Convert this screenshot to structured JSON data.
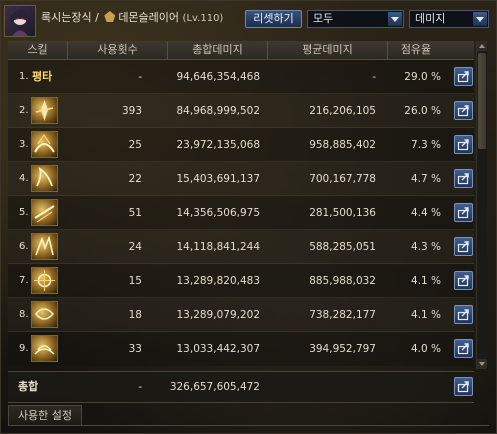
{
  "header": {
    "character_name": "록시는장식 / ",
    "class_name": "데몬슬레이어",
    "level": "(Lv.110)",
    "reset_button": "리셋하기",
    "filter_dropdown": "모두",
    "metric_dropdown": "데미지"
  },
  "table": {
    "columns": [
      "스킬",
      "사용횟수",
      "총합데미지",
      "평균데미지",
      "점유율"
    ],
    "rows": [
      {
        "rank": "1.",
        "skill_text": "평타",
        "uses": "-",
        "total": "94,646,354,468",
        "avg": "-",
        "share": "29.0 %"
      },
      {
        "rank": "2.",
        "skill_icon": "demon-skill-icon-1",
        "uses": "393",
        "total": "84,968,999,502",
        "avg": "216,206,105",
        "share": "26.0 %"
      },
      {
        "rank": "3.",
        "skill_icon": "demon-skill-icon-2",
        "uses": "25",
        "total": "23,972,135,068",
        "avg": "958,885,402",
        "share": "7.3 %"
      },
      {
        "rank": "4.",
        "skill_icon": "demon-skill-icon-3",
        "uses": "22",
        "total": "15,403,691,137",
        "avg": "700,167,778",
        "share": "4.7 %"
      },
      {
        "rank": "5.",
        "skill_icon": "demon-skill-icon-4",
        "uses": "51",
        "total": "14,356,506,975",
        "avg": "281,500,136",
        "share": "4.4 %"
      },
      {
        "rank": "6.",
        "skill_icon": "demon-skill-icon-5",
        "uses": "24",
        "total": "14,118,841,244",
        "avg": "588,285,051",
        "share": "4.3 %"
      },
      {
        "rank": "7.",
        "skill_icon": "demon-skill-icon-6",
        "uses": "15",
        "total": "13,289,820,483",
        "avg": "885,988,032",
        "share": "4.1 %"
      },
      {
        "rank": "8.",
        "skill_icon": "demon-skill-icon-7",
        "uses": "18",
        "total": "13,289,079,202",
        "avg": "738,282,177",
        "share": "4.1 %"
      },
      {
        "rank": "9.",
        "skill_icon": "demon-skill-icon-8",
        "uses": "33",
        "total": "13,033,442,307",
        "avg": "394,952,797",
        "share": "4.0 %"
      }
    ]
  },
  "total": {
    "label": "총합",
    "uses": "-",
    "total": "326,657,605,472",
    "avg": "",
    "share": ""
  },
  "footer": {
    "settings_tab": "사용한 설정"
  },
  "colors": {
    "accent_blue": "#36527e",
    "skill_gold": "#ffd86a"
  }
}
